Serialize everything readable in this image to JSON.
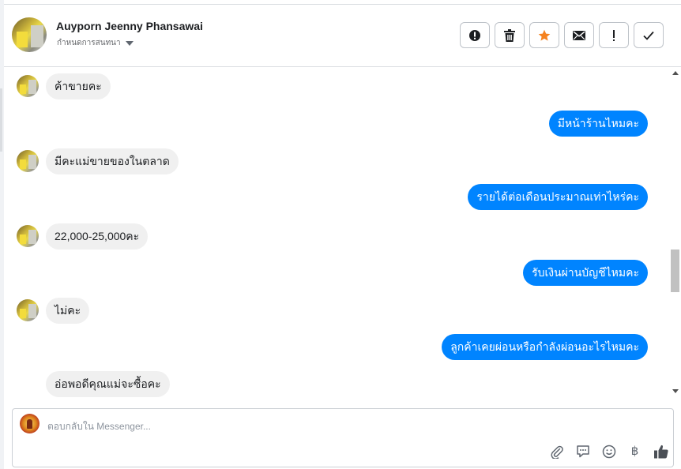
{
  "header": {
    "contact_name": "Auyporn Jeenny Phansawai",
    "conversation_settings": "กำหนดการสนทนา",
    "actions": [
      {
        "name": "mark-spam-button",
        "icon": "alert-circle-icon"
      },
      {
        "name": "delete-button",
        "icon": "trash-icon"
      },
      {
        "name": "star-button",
        "icon": "star-icon"
      },
      {
        "name": "mark-unread-button",
        "icon": "envelope-icon"
      },
      {
        "name": "mark-important-button",
        "icon": "exclamation-icon"
      },
      {
        "name": "mark-done-button",
        "icon": "check-icon"
      }
    ]
  },
  "messages": [
    {
      "direction": "in",
      "text": "ค้าขายคะ"
    },
    {
      "direction": "out",
      "text": "มีหน้าร้านไหมคะ"
    },
    {
      "direction": "in",
      "text": "มีคะแม่ขายของในตลาด"
    },
    {
      "direction": "out",
      "text": "รายได้ต่อเดือนประมาณเท่าไหร่คะ"
    },
    {
      "direction": "in",
      "text": "22,000-25,000คะ"
    },
    {
      "direction": "out",
      "text": "รับเงินผ่านบัญชีไหมคะ"
    },
    {
      "direction": "in",
      "text": "ไม่คะ"
    },
    {
      "direction": "out",
      "text": "ลูกค้าเคยผ่อนหรือกำลังผ่อนอะไรไหมคะ"
    },
    {
      "direction": "in",
      "text": "อ่อพอดีคุณแม่จะซื้อคะ"
    }
  ],
  "composer": {
    "placeholder": "ตอบกลับใน Messenger...",
    "tools": {
      "attach": "paperclip-icon",
      "quick_reply": "speech-bubble-icon",
      "emoji": "smiley-icon",
      "payment": "฿",
      "like": "thumbs-up-icon"
    }
  },
  "colors": {
    "outgoing_bubble": "#0084ff",
    "incoming_bubble": "#f0f0f0",
    "star": "#f5821f",
    "border": "#dadde1"
  }
}
